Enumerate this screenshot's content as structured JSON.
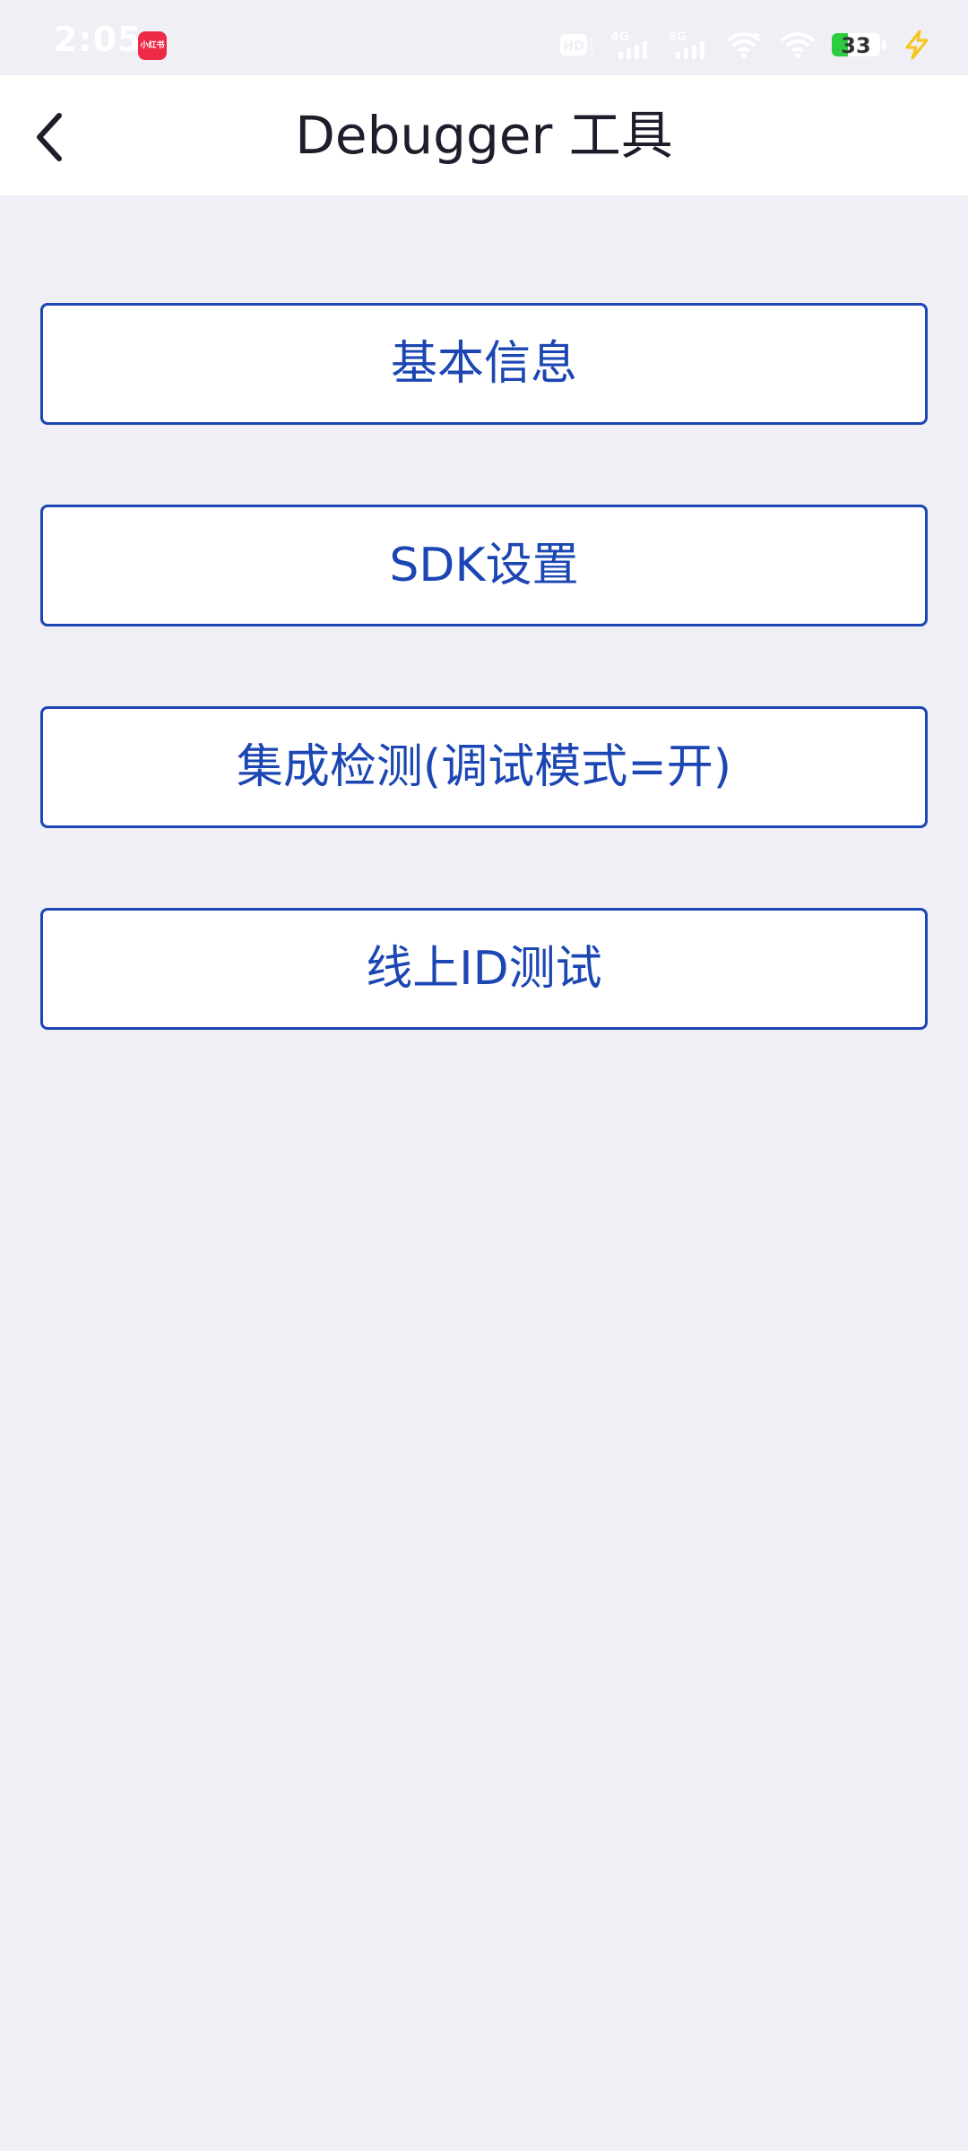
{
  "status_bar": {
    "time": "2:05",
    "app_badge_label": "小红书",
    "hd_label": "HD",
    "network_4g": "4G",
    "network_5g": "5G",
    "battery_level": "33"
  },
  "header": {
    "title": "Debugger 工具",
    "back_icon": "chevron-left-icon"
  },
  "menu": {
    "items": [
      {
        "label": "基本信息"
      },
      {
        "label": "SDK设置"
      },
      {
        "label": "集成检测(调试模式=开)"
      },
      {
        "label": "线上ID测试"
      }
    ]
  },
  "colors": {
    "accent": "#1b46b3",
    "background": "#efeff5",
    "header_bg": "#ffffff",
    "title_text": "#1d1d2b"
  }
}
